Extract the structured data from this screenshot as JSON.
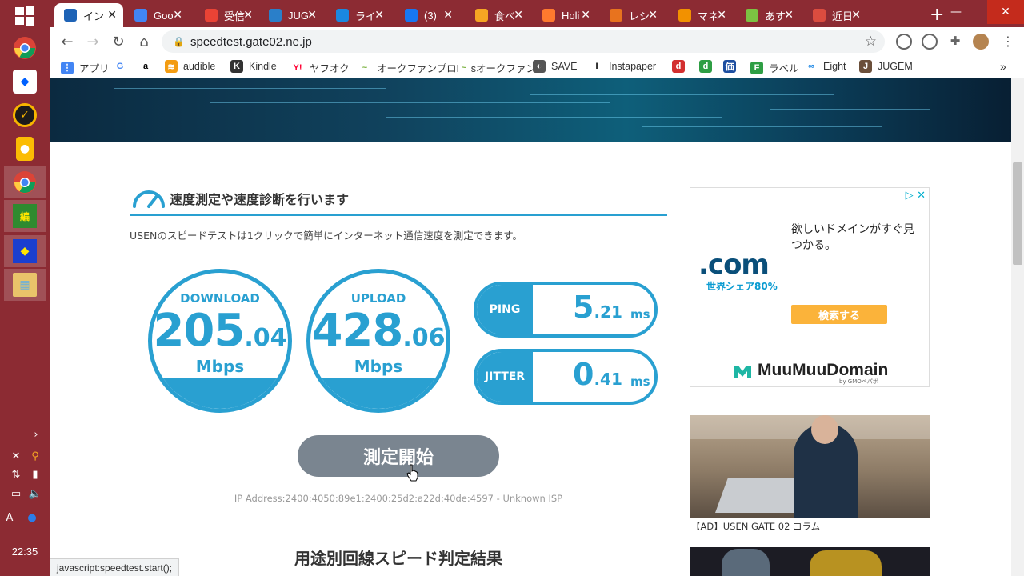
{
  "taskbar": {
    "clock": "22:35",
    "ime": "A"
  },
  "browser": {
    "tabs": [
      {
        "title": "インタ",
        "active": true,
        "color": "#1e63b6"
      },
      {
        "title": "Goo",
        "color": "#4285f4"
      },
      {
        "title": "受信",
        "color": "#ea4335"
      },
      {
        "title": "JUG",
        "color": "#2a7fc9"
      },
      {
        "title": "ライ",
        "color": "#1a88e0"
      },
      {
        "title": "(3)",
        "color": "#1877f2"
      },
      {
        "title": "食べ",
        "color": "#f5a623"
      },
      {
        "title": "Holi",
        "color": "#ff7a2e"
      },
      {
        "title": "レシ",
        "color": "#e8731e"
      },
      {
        "title": "マネ",
        "color": "#f29100"
      },
      {
        "title": "あす",
        "color": "#7cc242"
      },
      {
        "title": "近日",
        "color": "#db4c3f"
      }
    ],
    "url": "speedtest.gate02.ne.jp",
    "bookmarks": [
      {
        "label": "アプリ",
        "color": "#4285f4",
        "glyph": "⋮"
      },
      {
        "label": "",
        "color": "#ffffff",
        "glyph": "G"
      },
      {
        "label": "",
        "color": "#ffffff",
        "glyph": "a"
      },
      {
        "label": "audible",
        "color": "#f39c12",
        "glyph": "≋"
      },
      {
        "label": "Kindle",
        "color": "#333333",
        "glyph": "K"
      },
      {
        "label": "ヤフオク",
        "color": "#ffffff",
        "glyph": "Y!"
      },
      {
        "label": "オークファンプロPlus",
        "color": "#ffffff",
        "glyph": "~"
      },
      {
        "label": "オークファン",
        "color": "#ffffff",
        "glyph": "~"
      },
      {
        "label": "SAVE",
        "color": "#555555",
        "glyph": "◐"
      },
      {
        "label": "Instapaper",
        "color": "#ffffff",
        "glyph": "I"
      },
      {
        "label": "",
        "color": "#d32f2f",
        "glyph": "d"
      },
      {
        "label": "",
        "color": "#2e9e44",
        "glyph": "d"
      },
      {
        "label": "",
        "color": "#1e4fa0",
        "glyph": "価"
      },
      {
        "label": "ラベル",
        "color": "#2e9e44",
        "glyph": "F"
      },
      {
        "label": "Eight",
        "color": "#ffffff",
        "glyph": "∞"
      },
      {
        "label": "JUGEM",
        "color": "#6b4f3a",
        "glyph": "J"
      }
    ],
    "more_bookmarks": "»",
    "status_text": "javascript:speedtest.start();"
  },
  "page": {
    "section_title": "速度測定や速度診断を行います",
    "description": "USENのスピードテストは1クリックで簡単にインターネット通信速度を測定できます。",
    "download": {
      "label": "DOWNLOAD",
      "int": "205",
      "dec": ".04",
      "unit": "Mbps"
    },
    "upload": {
      "label": "UPLOAD",
      "int": "428",
      "dec": ".06",
      "unit": "Mbps"
    },
    "ping": {
      "label": "PING",
      "int": "5",
      "dec": ".21",
      "unit": "ms"
    },
    "jitter": {
      "label": "JITTER",
      "int": "0",
      "dec": ".41",
      "unit": "ms"
    },
    "start_button": "測定開始",
    "ip_line": "IP Address:2400:4050:89e1:2400:25d2:a22d:40de:4597 - Unknown ISP",
    "results_heading": "用途別回線スピード判定結果"
  },
  "ads": {
    "ad1": {
      "dotcom": ".com",
      "share": "世界シェア80%",
      "headline": "欲しいドメインがすぐ見つかる。",
      "search_button": "検索する",
      "brand": "MuuMuuDomain",
      "by": "by GMOペパボ",
      "adchoice": "▷ ✕"
    },
    "ad2_caption": "【AD】USEN GATE 02 コラム"
  },
  "colors": {
    "accent": "#29a0d1",
    "taskbar": "#8c2b33",
    "start_button": "#7a8590"
  }
}
